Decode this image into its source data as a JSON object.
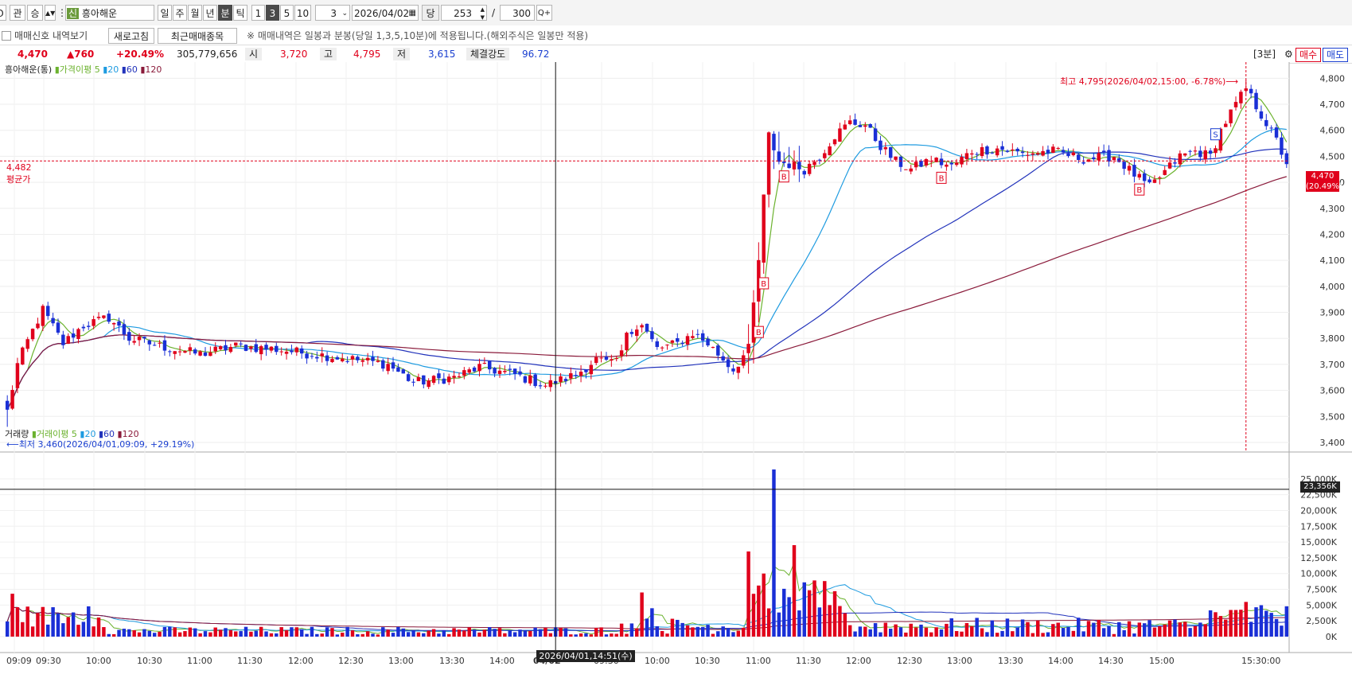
{
  "toolbar": {
    "left_icon": "O",
    "btn_gwan": "관",
    "btn_seung": "승",
    "stock_badge": "신",
    "stock_name": "흥아해운",
    "periods": [
      "일",
      "주",
      "월",
      "년",
      "분",
      "틱"
    ],
    "active_period": "분",
    "minutes": [
      "1",
      "3",
      "5",
      "10"
    ],
    "active_minute": "3",
    "interval_value": "3",
    "date": "2026/04/02",
    "dang_label": "당",
    "count": "253",
    "slash": "/",
    "max": "300",
    "zoom_icon": "Q+"
  },
  "toolbar2": {
    "checkbox_label": "매매신호 내역보기",
    "refresh_label": "새로고침",
    "recent_label": "최근매매종목",
    "notice": "※ 매매내역은 일봉과 분봉(당일 1,3,5,10분)에 적용됩니다.(해외주식은 일봉만 적용)"
  },
  "quote": {
    "price": "4,470",
    "change": "▲760",
    "change_pct": "+20.49%",
    "volume": "305,779,656",
    "open_label": "시",
    "open": "3,720",
    "high_label": "고",
    "high": "4,795",
    "low_label": "저",
    "low": "3,615",
    "strength_label": "체결강도",
    "strength": "96.72",
    "period_tag": "[3분]",
    "buy": "매수",
    "sell": "매도"
  },
  "price_panel": {
    "legend_name": "흥아해운(통)",
    "legend_ma_label": "가격이평",
    "ma_periods": [
      "5",
      "20",
      "60",
      "120"
    ],
    "avg_price": "4,482",
    "avg_label": "평균가",
    "high_note": "최고 4,795(2026/04/02,15:00, -6.78%)",
    "low_note": "최저 3,460(2026/04/01,09:09, +29.19%)",
    "current_tag": "4,470",
    "current_tag_pct": "(20.49%)"
  },
  "volume_panel": {
    "legend_name": "거래량",
    "legend_ma_label": "거래이평",
    "ma_periods": [
      "5",
      "20",
      "60",
      "120"
    ],
    "crosshair_value": "23,356K"
  },
  "cursor_label": "2026/04/01,14:51(수)",
  "colors": {
    "up": "#e0001b",
    "down": "#1a2fd6",
    "ma5": "#6bb22e",
    "ma20": "#1e9be0",
    "ma60": "#2233bb",
    "ma120": "#8a1a3a"
  },
  "chart_data": [
    {
      "type": "candlestick",
      "title": "흥아해운(통)",
      "interval": "3분",
      "ylim": [
        3400,
        4850
      ],
      "y_ticks": [
        "3,400",
        "3,500",
        "3,600",
        "3,700",
        "3,800",
        "3,900",
        "4,000",
        "4,100",
        "4,200",
        "4,300",
        "4,400",
        "4,500",
        "4,600",
        "4,700",
        "4,800"
      ],
      "x_ticks": [
        "09:09",
        "09:30",
        "10:00",
        "10:30",
        "11:00",
        "11:30",
        "12:00",
        "12:30",
        "13:00",
        "13:30",
        "14:00",
        "04/02",
        "09:30",
        "10:00",
        "10:30",
        "11:00",
        "11:30",
        "12:00",
        "12:30",
        "13:00",
        "13:30",
        "14:00",
        "14:30",
        "15:00",
        "15:30:00"
      ],
      "anchors": [
        {
          "bar": 0,
          "price": 3520
        },
        {
          "bar": 2,
          "price": 3700
        },
        {
          "bar": 4,
          "price": 3790
        },
        {
          "bar": 7,
          "price": 3910
        },
        {
          "bar": 11,
          "price": 3780
        },
        {
          "bar": 15,
          "price": 3850
        },
        {
          "bar": 20,
          "price": 3880
        },
        {
          "bar": 24,
          "price": 3800
        },
        {
          "bar": 30,
          "price": 3770
        },
        {
          "bar": 38,
          "price": 3740
        },
        {
          "bar": 45,
          "price": 3770
        },
        {
          "bar": 52,
          "price": 3760
        },
        {
          "bar": 60,
          "price": 3740
        },
        {
          "bar": 68,
          "price": 3720
        },
        {
          "bar": 75,
          "price": 3700
        },
        {
          "bar": 80,
          "price": 3630
        },
        {
          "bar": 88,
          "price": 3650
        },
        {
          "bar": 93,
          "price": 3690
        },
        {
          "bar": 100,
          "price": 3660
        },
        {
          "bar": 106,
          "price": 3620
        },
        {
          "bar": 112,
          "price": 3660
        },
        {
          "bar": 116,
          "price": 3720
        },
        {
          "bar": 119,
          "price": 3700
        },
        {
          "bar": 121,
          "price": 3740
        },
        {
          "bar": 122,
          "price": 3830
        },
        {
          "bar": 125,
          "price": 3850
        },
        {
          "bar": 128,
          "price": 3760
        },
        {
          "bar": 132,
          "price": 3780
        },
        {
          "bar": 135,
          "price": 3820
        },
        {
          "bar": 138,
          "price": 3780
        },
        {
          "bar": 141,
          "price": 3720
        },
        {
          "bar": 143,
          "price": 3680
        },
        {
          "bar": 146,
          "price": 3760
        },
        {
          "bar": 148,
          "price": 4100
        },
        {
          "bar": 150,
          "price": 4580
        },
        {
          "bar": 152,
          "price": 4480
        },
        {
          "bar": 154,
          "price": 4470
        },
        {
          "bar": 157,
          "price": 4450
        },
        {
          "bar": 160,
          "price": 4500
        },
        {
          "bar": 163,
          "price": 4580
        },
        {
          "bar": 166,
          "price": 4630
        },
        {
          "bar": 169,
          "price": 4620
        },
        {
          "bar": 172,
          "price": 4540
        },
        {
          "bar": 175,
          "price": 4480
        },
        {
          "bar": 178,
          "price": 4450
        },
        {
          "bar": 182,
          "price": 4490
        },
        {
          "bar": 186,
          "price": 4460
        },
        {
          "bar": 190,
          "price": 4520
        },
        {
          "bar": 195,
          "price": 4530
        },
        {
          "bar": 200,
          "price": 4510
        },
        {
          "bar": 206,
          "price": 4520
        },
        {
          "bar": 212,
          "price": 4490
        },
        {
          "bar": 218,
          "price": 4500
        },
        {
          "bar": 222,
          "price": 4430
        },
        {
          "bar": 225,
          "price": 4380
        },
        {
          "bar": 228,
          "price": 4440
        },
        {
          "bar": 231,
          "price": 4500
        },
        {
          "bar": 234,
          "price": 4520
        },
        {
          "bar": 237,
          "price": 4500
        },
        {
          "bar": 239,
          "price": 4600
        },
        {
          "bar": 242,
          "price": 4700
        },
        {
          "bar": 244,
          "price": 4760
        },
        {
          "bar": 247,
          "price": 4660
        },
        {
          "bar": 250,
          "price": 4560
        },
        {
          "bar": 252,
          "price": 4470
        }
      ],
      "markers": [
        {
          "bar": 148,
          "label": "B"
        },
        {
          "bar": 149,
          "label": "B"
        },
        {
          "bar": 153,
          "label": "B"
        },
        {
          "bar": 184,
          "label": "B"
        },
        {
          "bar": 223,
          "label": "B"
        },
        {
          "bar": 238,
          "label": "S"
        }
      ]
    },
    {
      "type": "bar",
      "title": "거래량",
      "ylim": [
        0,
        27500
      ],
      "y_ticks": [
        "0K",
        "2,500K",
        "5,000K",
        "7,500K",
        "10,000K",
        "12,500K",
        "15,000K",
        "17,500K",
        "20,000K",
        "22,500K",
        "25,000K"
      ],
      "peaks": [
        {
          "bar": 1,
          "value": 6800
        },
        {
          "bar": 10,
          "value": 3700
        },
        {
          "bar": 16,
          "value": 4800
        },
        {
          "bar": 125,
          "value": 7000
        },
        {
          "bar": 127,
          "value": 4500
        },
        {
          "bar": 146,
          "value": 13500
        },
        {
          "bar": 149,
          "value": 10000
        },
        {
          "bar": 151,
          "value": 26500
        },
        {
          "bar": 155,
          "value": 14500
        },
        {
          "bar": 162,
          "value": 5000
        },
        {
          "bar": 244,
          "value": 5500
        }
      ]
    }
  ]
}
